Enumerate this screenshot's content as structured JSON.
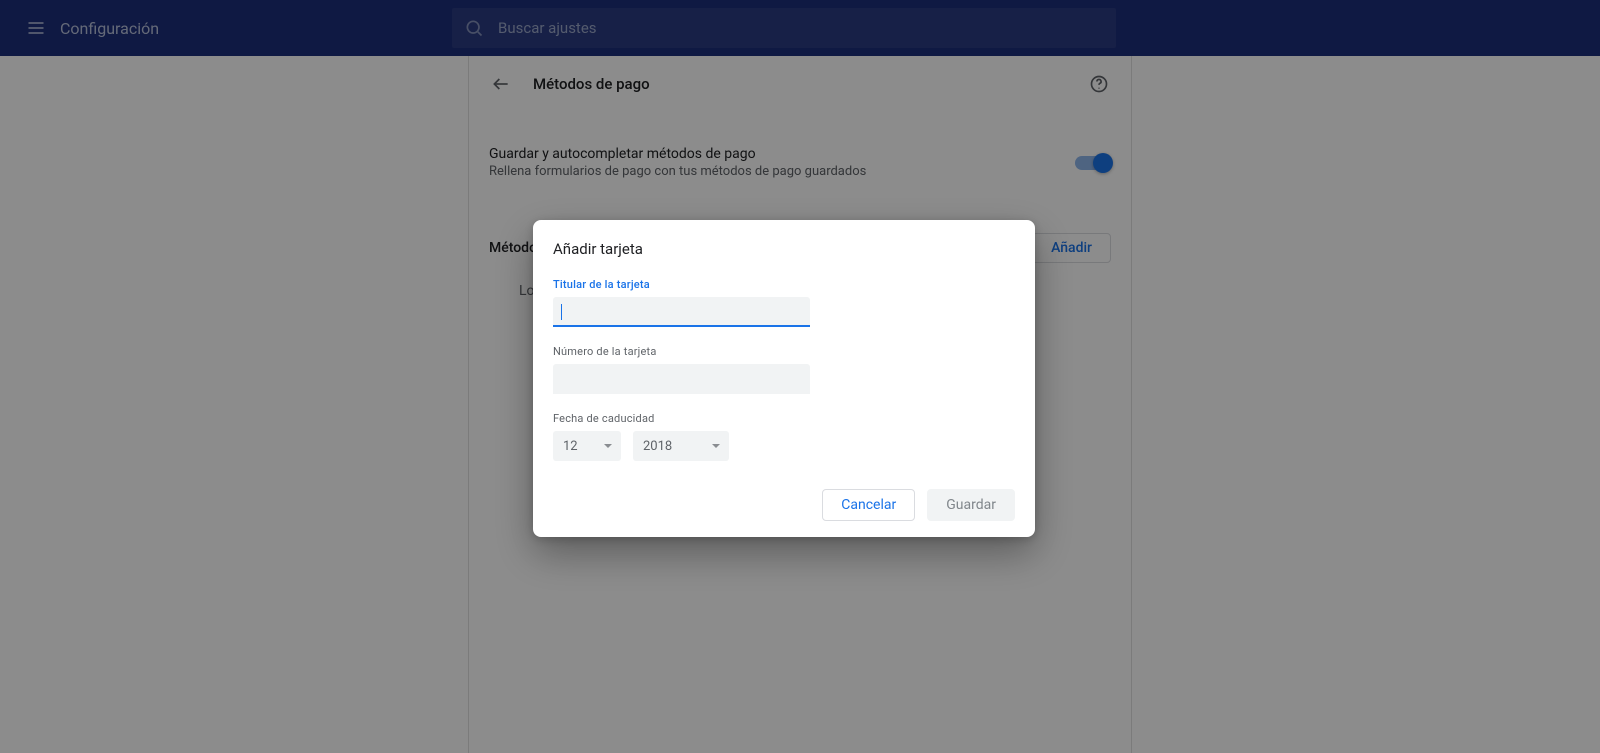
{
  "header": {
    "title": "Configuración",
    "search_placeholder": "Buscar ajustes"
  },
  "panel": {
    "title": "Métodos de pago",
    "setting": {
      "title": "Guardar y autocompletar métodos de pago",
      "subtitle": "Rellena formularios de pago con tus métodos de pago guardados"
    },
    "section_title": "Métodos de pago",
    "add_button": "Añadir",
    "empty_prefix": "Los"
  },
  "dialog": {
    "title": "Añadir tarjeta",
    "cardholder_label": "Titular de la tarjeta",
    "cardholder_value": "",
    "cardnumber_label": "Número de la tarjeta",
    "cardnumber_value": "",
    "expiry_label": "Fecha de caducidad",
    "month": "12",
    "year": "2018",
    "cancel": "Cancelar",
    "save": "Guardar"
  }
}
